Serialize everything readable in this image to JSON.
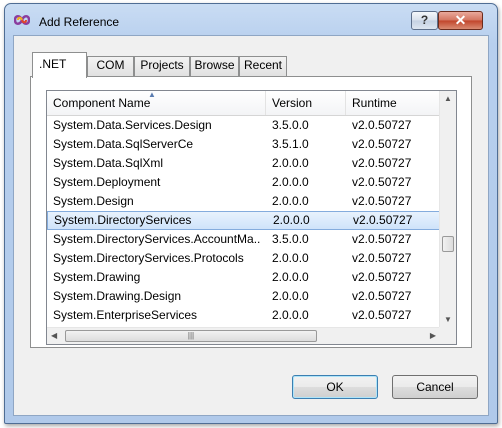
{
  "window": {
    "title": "Add Reference",
    "help_label": "?",
    "close_label": "✕"
  },
  "tabs": [
    {
      "label": ".NET",
      "active": true
    },
    {
      "label": "COM"
    },
    {
      "label": "Projects"
    },
    {
      "label": "Browse"
    },
    {
      "label": "Recent"
    }
  ],
  "columns": {
    "name": "Component Name",
    "version": "Version",
    "runtime": "Runtime"
  },
  "rows": [
    {
      "name": "System.Data.Services.Design",
      "version": "3.5.0.0",
      "runtime": "v2.0.50727"
    },
    {
      "name": "System.Data.SqlServerCe",
      "version": "3.5.1.0",
      "runtime": "v2.0.50727"
    },
    {
      "name": "System.Data.SqlXml",
      "version": "2.0.0.0",
      "runtime": "v2.0.50727"
    },
    {
      "name": "System.Deployment",
      "version": "2.0.0.0",
      "runtime": "v2.0.50727"
    },
    {
      "name": "System.Design",
      "version": "2.0.0.0",
      "runtime": "v2.0.50727"
    },
    {
      "name": "System.DirectoryServices",
      "version": "2.0.0.0",
      "runtime": "v2.0.50727",
      "selected": true
    },
    {
      "name": "System.DirectoryServices.AccountMa...",
      "version": "3.5.0.0",
      "runtime": "v2.0.50727"
    },
    {
      "name": "System.DirectoryServices.Protocols",
      "version": "2.0.0.0",
      "runtime": "v2.0.50727"
    },
    {
      "name": "System.Drawing",
      "version": "2.0.0.0",
      "runtime": "v2.0.50727"
    },
    {
      "name": "System.Drawing.Design",
      "version": "2.0.0.0",
      "runtime": "v2.0.50727"
    },
    {
      "name": "System.EnterpriseServices",
      "version": "2.0.0.0",
      "runtime": "v2.0.50727"
    }
  ],
  "buttons": {
    "ok": "OK",
    "cancel": "Cancel"
  },
  "icons": {
    "app": "visual-studio-logo-icon",
    "sort": "sort-ascending-icon"
  }
}
